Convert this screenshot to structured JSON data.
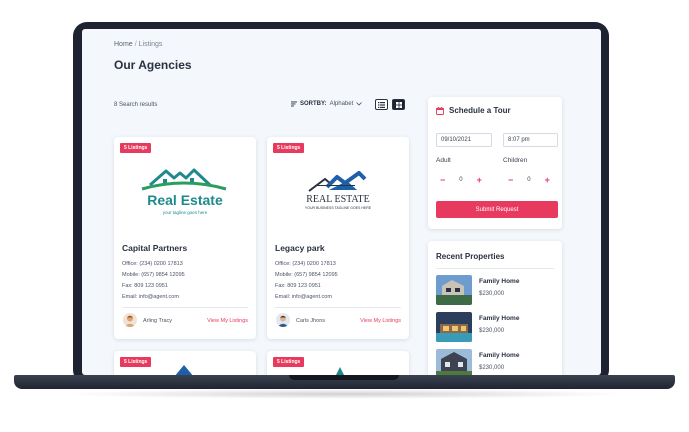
{
  "breadcrumb": {
    "home": "Home",
    "separator": "/",
    "current": "Listings"
  },
  "page_title": "Our Agencies",
  "toolbar": {
    "results": "8 Search results",
    "sortby_label": "SORTBY:",
    "sortby_value": "Alphabet",
    "list_view_icon": "list-view-icon",
    "grid_view_icon": "grid-view-icon"
  },
  "agencies": [
    {
      "badge": "5 Listings",
      "logo_title": "Real Estate",
      "logo_tagline": "your tagline goes here",
      "name": "Capital Partners",
      "office": "Office: (234) 0200 17813",
      "mobile": "Mobile: (657) 9854 12095",
      "fax": "Fax: 809 123 0951",
      "email": "Email: info@agent.com",
      "agent": "Arling Tracy",
      "link": "View My Listings"
    },
    {
      "badge": "5 Listings",
      "logo_title": "REAL ESTATE",
      "logo_tagline": "YOUR BUSINESS TAGLINE GOES HERE",
      "name": "Legacy park",
      "office": "Office: (234) 0200 17813",
      "mobile": "Mobile: (657) 9854 12095",
      "fax": "Fax: 809 123 0951",
      "email": "Email: info@agent.com",
      "agent": "Carls Jhons",
      "link": "View My Listings"
    },
    {
      "badge": "5 Listings"
    },
    {
      "badge": "5 Listings"
    }
  ],
  "tour": {
    "title": "Schedule a Tour",
    "icon": "calendar-icon",
    "date": "09/10/2021",
    "time": "8:07 pm",
    "adult_label": "Adult",
    "children_label": "Children",
    "adult_value": "0",
    "children_value": "0",
    "minus": "−",
    "plus": "+",
    "submit": "Submit Request"
  },
  "recent": {
    "title": "Recent Properties",
    "items": [
      {
        "name": "Family Home",
        "price": "$230,000"
      },
      {
        "name": "Family Home",
        "price": "$230,000"
      },
      {
        "name": "Family Home",
        "price": "$230,000"
      }
    ]
  },
  "colors": {
    "accent": "#e83a5f",
    "dark": "#1d2330",
    "teal": "#1f8a8c",
    "blue": "#1d5fa8"
  }
}
